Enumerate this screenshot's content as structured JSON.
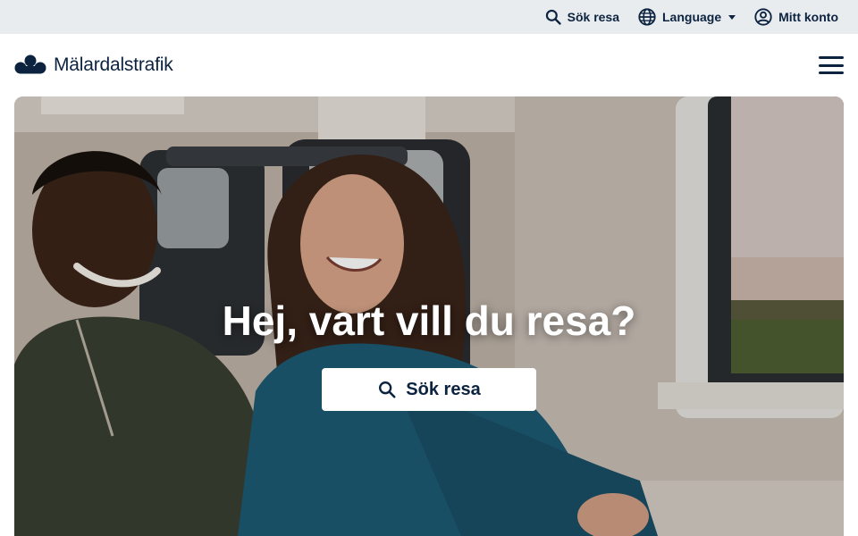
{
  "utility": {
    "search_label": "Sök resa",
    "language_label": "Language",
    "account_label": "Mitt konto"
  },
  "header": {
    "logo_text": "Mälardalstrafik",
    "menu_icon": "hamburger-menu-icon"
  },
  "hero": {
    "title": "Hej, vart vill du resa?",
    "search_button_label": "Sök resa",
    "image_description_icon": "photo"
  },
  "colors": {
    "navy": "#0c2340",
    "utility_bg": "#e9ecef",
    "white": "#ffffff"
  }
}
